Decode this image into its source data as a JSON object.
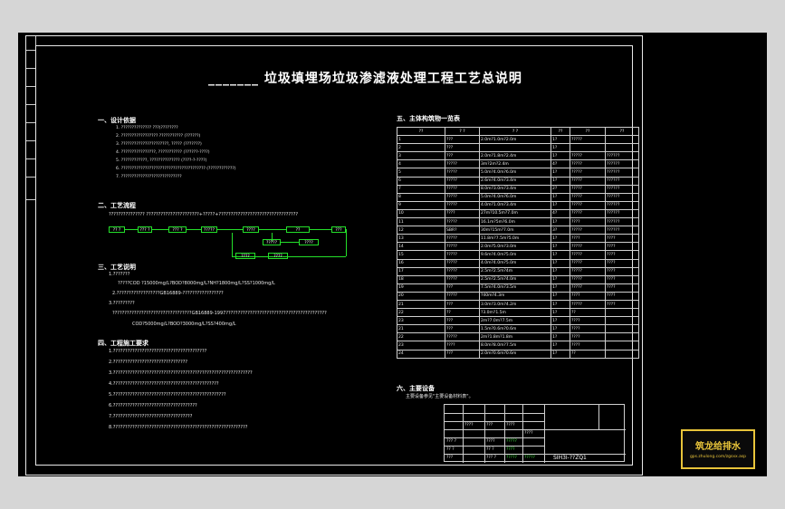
{
  "sheet": {
    "title": "_______  垃圾填埋场垃圾渗滤液处理工程工艺总说明",
    "drawing_no": "SIH3I-??ZQ1"
  },
  "sections": {
    "s1": {
      "heading": "一、设计依据",
      "items": [
        "1. ??????????????   ???(????????",
        "2. ?????????????????   ??????????? (??????)",
        "3. ??????????????????????,  ????? (???????)",
        "4. ????????????????,  ???????????  (??????-????)",
        "5. ????????????,  ??????????????  (????-?-????)",
        "6. ???????????????????????????????????????   (????????????)",
        "7. ????????????????????????????"
      ]
    },
    "s2": {
      "heading": "二、工艺流程",
      "text": "???????????????   ??????????????????????+?????+?????????????????????????????????"
    },
    "s3": {
      "heading": "三、工艺说明",
      "lines": [
        "1.???????",
        "?????COD ?15000mg/L?BOD?8000mg/L?NH?1800mg/L?SS?1000mg/L",
        "2.??????????????????GB16889-?????????????????",
        "3.?????????",
        "?????????????????????????????????GB16889-1997??????????????????????????????????????????",
        "COD?5000mg/L?BOD?3000mg/L?SS?400mg/L"
      ]
    },
    "s4": {
      "heading": "四、工程施工要求",
      "lines": [
        "1.???????????????????????????????????????",
        "2.???????????????????????????????",
        "3.??????????????????????????????????????????????????????????",
        "4.????????????????????????????????????????????",
        "5.???????????????????????????????????????????????",
        "6.???????????????????????????????????",
        "7.?????????????????????????????????",
        "8.????????????????????????????????????????????????????????"
      ]
    }
  },
  "flow": {
    "boxes": [
      "?? ?",
      "??? ?",
      "??? ?",
      "?????",
      "????",
      "??",
      "???",
      "?????",
      "????",
      "????",
      "????"
    ]
  },
  "equipment": {
    "heading": "五、主体构筑物一览表",
    "headers": [
      "??",
      "?  ?",
      "?   ?",
      "??",
      "??",
      "??"
    ],
    "rows": [
      [
        "1",
        "???",
        "2.0m?1.0m?2.0m",
        "1?",
        "?????",
        ""
      ],
      [
        "2",
        "???",
        "",
        "1?",
        "",
        ""
      ],
      [
        "3",
        "???",
        "2.0m?1.8m?2.4m",
        "1?",
        "?????",
        "??????"
      ],
      [
        "4",
        "?????",
        "3m?2m?2.4m",
        "4?",
        "?????",
        "??????"
      ],
      [
        "5",
        "?????",
        "5.0m?4.0m?6.0m",
        "1?",
        "?????",
        "??????"
      ],
      [
        "6",
        "?????",
        "2.6m?4.0m?3.4m",
        "1?",
        "?????",
        "??????"
      ],
      [
        "7",
        "?????",
        "8.0m?3.0m?3.4m",
        "2?",
        "?????",
        "??????"
      ],
      [
        "8",
        "?????",
        "5.0m?4.0m?6.0m",
        "1?",
        "?????",
        "??????"
      ],
      [
        "9",
        "?????",
        "4.0m?1.0m?3.4m",
        "1?",
        "?????",
        "??????"
      ],
      [
        "10",
        "????",
        "27m?10.5m?7.0m",
        "4?",
        "?????",
        "??????"
      ],
      [
        "11",
        "?????",
        "16.1m?5m?6.0m",
        "1?",
        "????",
        "??????"
      ],
      [
        "12",
        "SBR?",
        "30m?15m?7.0m",
        "3?",
        "?????",
        "??????"
      ],
      [
        "13",
        "?????",
        "11.8m?7.5m?5.0m",
        "1?",
        "????",
        "????"
      ],
      [
        "14",
        "?????",
        "2.0m?5.0m?3.0m",
        "1?",
        "?????",
        "????"
      ],
      [
        "15",
        "?????",
        "9.6m?4.0m?5.0m",
        "1?",
        "?????",
        "????"
      ],
      [
        "16",
        "?????",
        "4.0m?4.0m?5.0m",
        "1?",
        "?????",
        "????"
      ],
      [
        "17",
        "?????",
        "2.5m?2.5m?4m",
        "1?",
        "?????",
        "????"
      ],
      [
        "18",
        "?????",
        "2.5m?2.5m?4.0m",
        "1?",
        "?????",
        "????"
      ],
      [
        "19",
        "???",
        "7.5m?4.0m?3.5m",
        "1?",
        "?????",
        "????"
      ],
      [
        "20",
        "?????",
        "?40m?4.3m",
        "1?",
        "????",
        "????"
      ],
      [
        "21",
        "???",
        "3.0m?3.0m?4.2m",
        "1?",
        "?????",
        "????"
      ],
      [
        "22",
        "??",
        "?3.0m?1.5m",
        "1?",
        "??",
        ""
      ],
      [
        "23",
        "???",
        "2m?7.0m?7.5m",
        "1?",
        "????",
        ""
      ],
      [
        "21",
        "???",
        "1.5m?0.6m?0.6m",
        "1?",
        "????",
        ""
      ],
      [
        "22",
        "?????",
        "2m?1.8m?1.8m",
        "1?",
        "????",
        ""
      ],
      [
        "23",
        "????",
        "8.0m?8.0m?7.5m",
        "1?",
        "????",
        ""
      ],
      [
        "24",
        "???",
        "2.0m?0.6m?0.6m",
        "1?",
        "??",
        ""
      ]
    ]
  },
  "main_equipment": {
    "heading": "六、主要设备",
    "text": "主要设备参见\"主要设备材料表\"。"
  },
  "title_block": {
    "cells": [
      "????",
      "???",
      "????",
      "????",
      "??? ?",
      "?? ?",
      "???",
      "????",
      "?? ?",
      "??? ?",
      "?? ?",
      "????",
      "?? ?",
      "????",
      "?? ?",
      "????"
    ],
    "green": [
      "?????",
      "????",
      "?????",
      "?????"
    ]
  },
  "logo": {
    "name": "筑龙给排水",
    "url": "gps.zhulong.com/zgsxx.asp"
  },
  "colors": {
    "background": "#000000",
    "frame": "#e8e8e8",
    "flow_lines": "#24e02a",
    "logo": "#e8c43a"
  }
}
